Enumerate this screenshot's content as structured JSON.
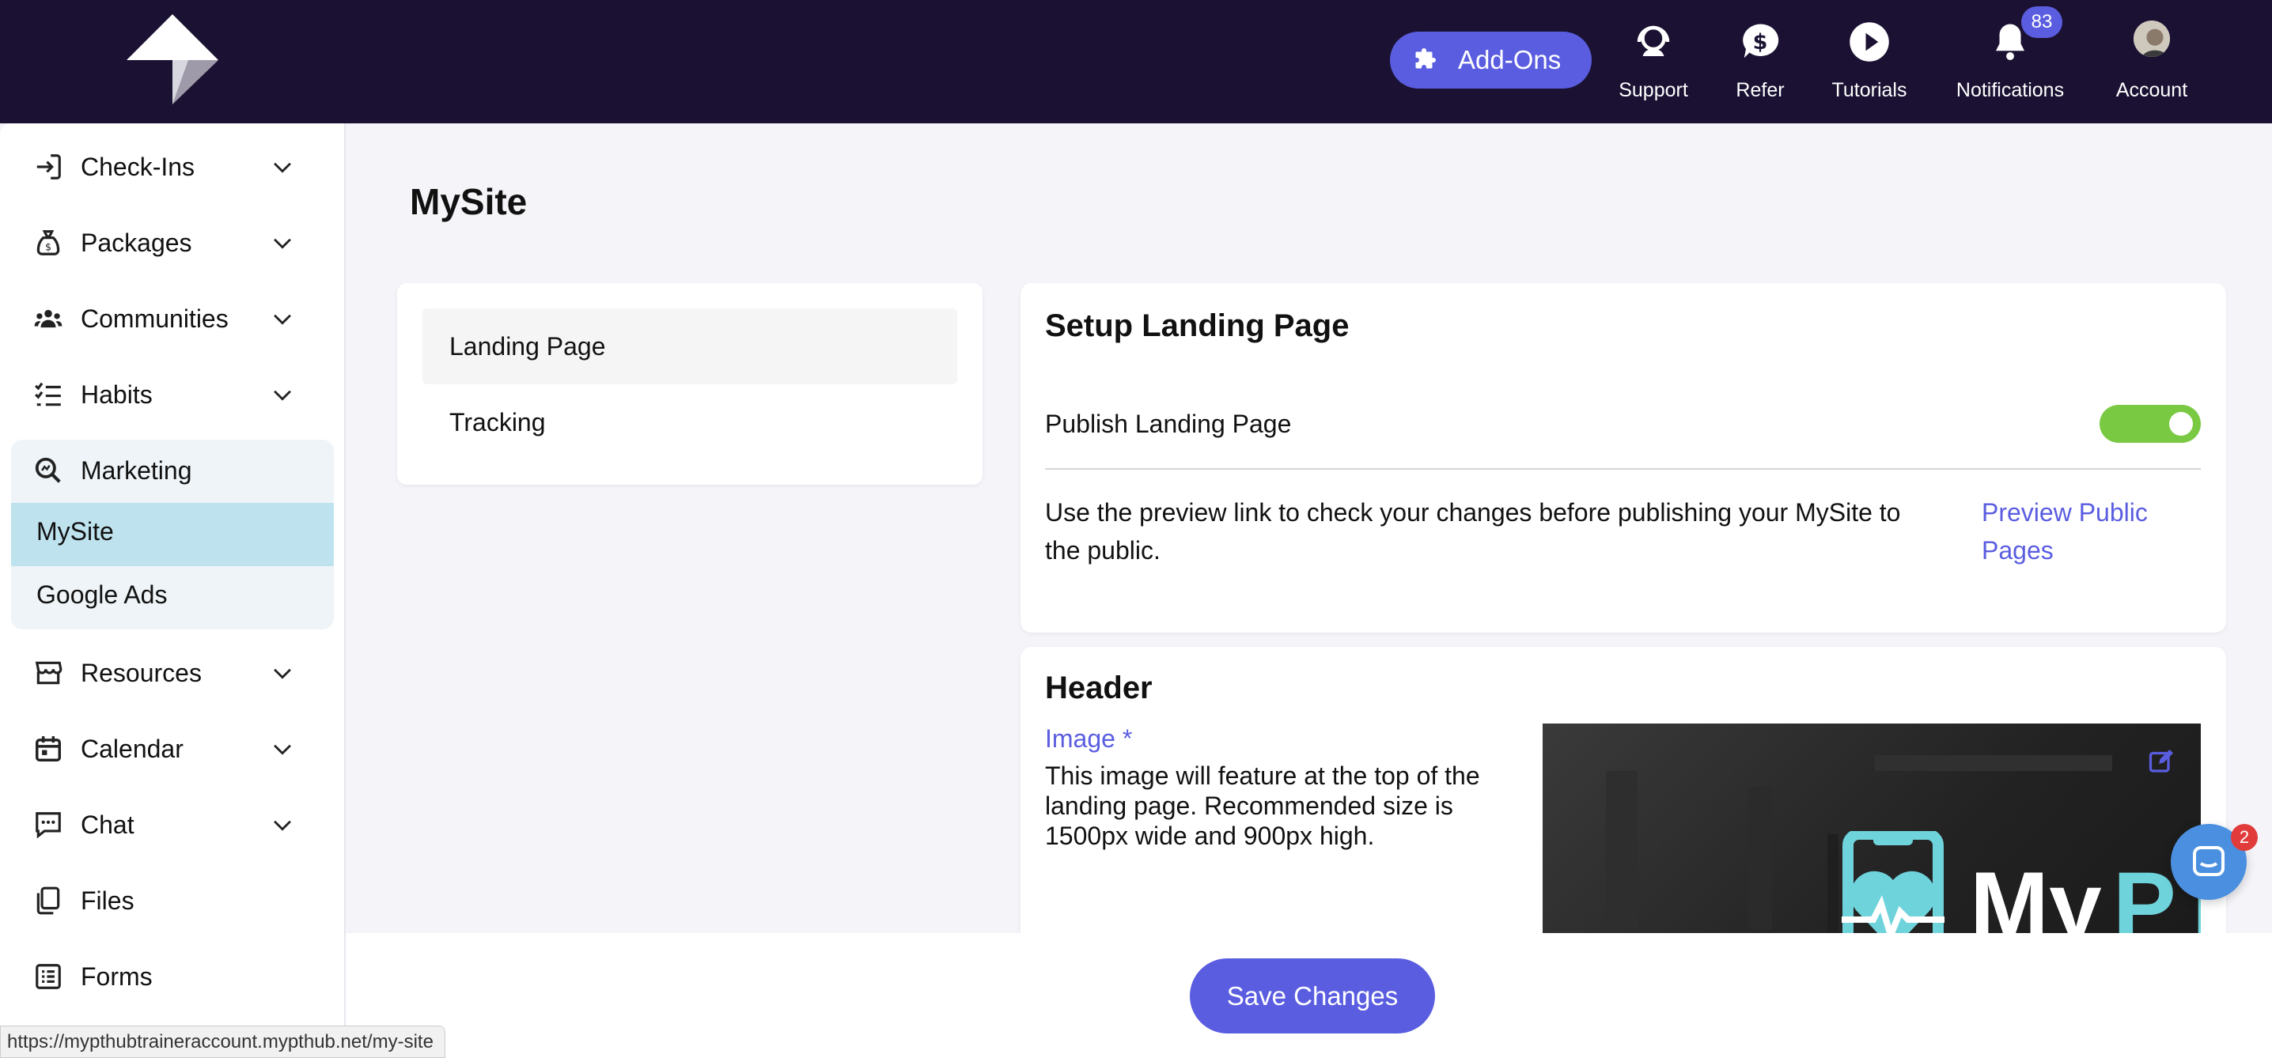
{
  "topbar": {
    "addons_label": "Add-Ons",
    "nav": [
      {
        "label": "Support",
        "icon": "support-icon"
      },
      {
        "label": "Refer",
        "icon": "dollar-icon"
      },
      {
        "label": "Tutorials",
        "icon": "play-icon"
      },
      {
        "label": "Notifications",
        "icon": "bell-icon"
      },
      {
        "label": "Account",
        "icon": "avatar"
      }
    ],
    "notification_count": "83"
  },
  "sidebar": {
    "items": [
      {
        "label": "Check-Ins",
        "icon": "check-in-icon"
      },
      {
        "label": "Packages",
        "icon": "money-bag-icon"
      },
      {
        "label": "Communities",
        "icon": "people-icon"
      },
      {
        "label": "Habits",
        "icon": "checklist-icon"
      },
      {
        "label": "Marketing",
        "icon": "magnifier-icon"
      },
      {
        "label": "Resources",
        "icon": "store-icon"
      },
      {
        "label": "Calendar",
        "icon": "calendar-icon"
      },
      {
        "label": "Chat",
        "icon": "chat-icon"
      },
      {
        "label": "Files",
        "icon": "files-icon"
      },
      {
        "label": "Forms",
        "icon": "form-icon"
      }
    ],
    "marketing_sub": [
      {
        "label": "MySite",
        "active": true
      },
      {
        "label": "Google Ads",
        "active": false
      }
    ]
  },
  "main": {
    "page_title": "MySite",
    "tabs": [
      {
        "label": "Landing Page",
        "active": true
      },
      {
        "label": "Tracking",
        "active": false
      }
    ],
    "setup": {
      "title": "Setup Landing Page",
      "publish_label": "Publish Landing Page",
      "publish_on": true,
      "preview_desc_1": "Use the preview link to check your changes before publishing your MySite to",
      "preview_desc_2": "the public.",
      "preview_link_1": "Preview Public",
      "preview_link_2": "Pages"
    },
    "header": {
      "title": "Header",
      "image_label": "Image *",
      "image_desc_1": "This image will feature at the top of the",
      "image_desc_2": "landing page. Recommended size is",
      "image_desc_3": "1500px wide and 900px high.",
      "logo_text_1": "My",
      "logo_text_2": "PT"
    },
    "save_label": "Save Changes"
  },
  "status_url": "https://mypthubtraineraccount.mypthub.net/my-site",
  "chat_unread": "2",
  "colors": {
    "topbar": "#1b1233",
    "accent": "#5a5de0",
    "toggle_on": "#7ac943",
    "active_nav": "#bfe3ee"
  }
}
